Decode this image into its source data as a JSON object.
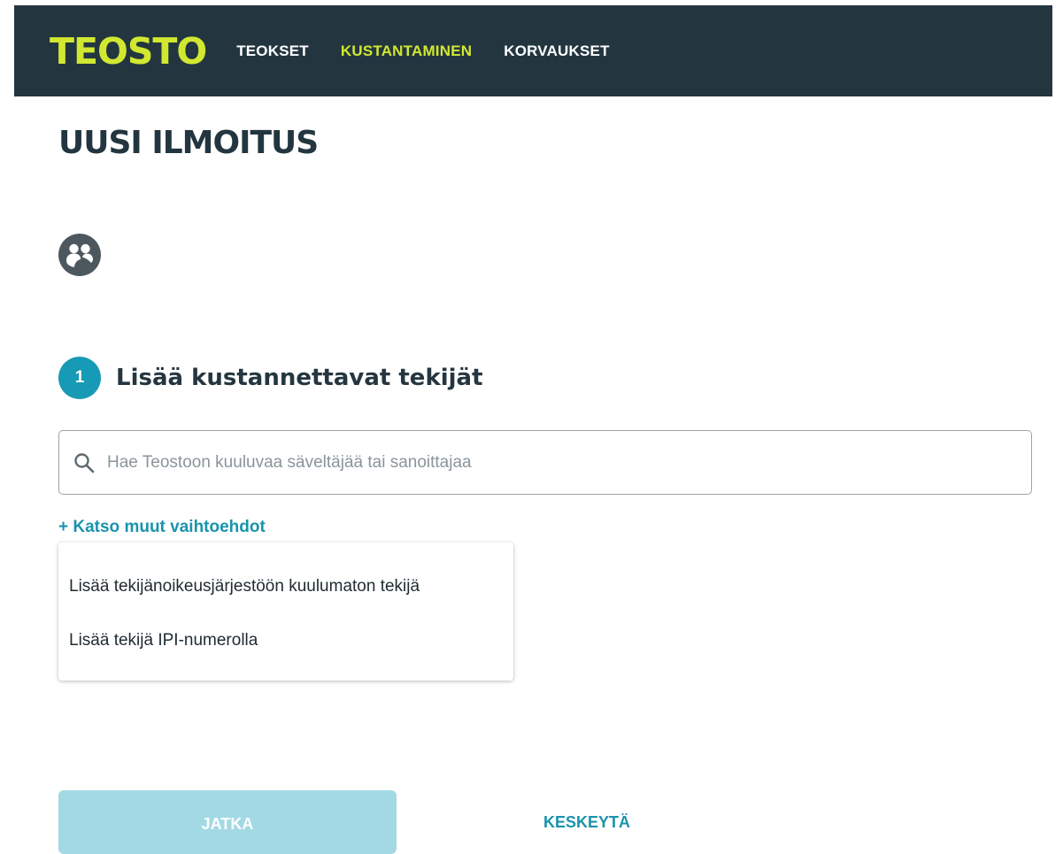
{
  "header": {
    "logo": "TEOSTO",
    "nav": [
      {
        "label": "TEOKSET",
        "active": false
      },
      {
        "label": "KUSTANTAMINEN",
        "active": true
      },
      {
        "label": "KORVAUKSET",
        "active": false
      }
    ]
  },
  "page": {
    "title": "UUSI ILMOITUS",
    "icon": "people-group-icon"
  },
  "step": {
    "number": "1",
    "title": "Lisää kustannettavat tekijät"
  },
  "search": {
    "placeholder": "Hae Teostoon kuuluvaa säveltäjää tai sanoittajaa",
    "value": ""
  },
  "more_options": {
    "label": "+ Katso muut vaihtoehdot",
    "items": [
      "Lisää tekijänoikeusjärjestöön kuulumaton tekijä",
      "Lisää tekijä IPI-numerolla"
    ]
  },
  "actions": {
    "continue_label": "JATKA",
    "cancel_label": "KESKEYTÄ"
  },
  "colors": {
    "header_bg": "#233640",
    "brand_accent": "#d2e830",
    "primary": "#179ab5",
    "button_disabled": "#a3d9e4"
  }
}
